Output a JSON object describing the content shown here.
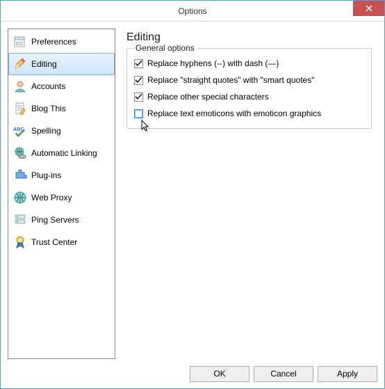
{
  "window": {
    "title": "Options"
  },
  "sidebar": {
    "items": [
      {
        "label": "Preferences"
      },
      {
        "label": "Editing"
      },
      {
        "label": "Accounts"
      },
      {
        "label": "Blog This"
      },
      {
        "label": "Spelling"
      },
      {
        "label": "Automatic Linking"
      },
      {
        "label": "Plug-ins"
      },
      {
        "label": "Web Proxy"
      },
      {
        "label": "Ping Servers"
      },
      {
        "label": "Trust Center"
      }
    ],
    "selected_index": 1
  },
  "content": {
    "heading": "Editing",
    "group_label": "General options",
    "options": [
      {
        "label": "Replace hyphens (--) with dash (—)",
        "checked": true
      },
      {
        "label": "Replace \"straight quotes\" with \"smart quotes\"",
        "checked": true
      },
      {
        "label": "Replace other special characters",
        "checked": true
      },
      {
        "label": "Replace text emoticons with emoticon graphics",
        "checked": false
      }
    ]
  },
  "buttons": {
    "ok": "OK",
    "cancel": "Cancel",
    "apply": "Apply"
  }
}
